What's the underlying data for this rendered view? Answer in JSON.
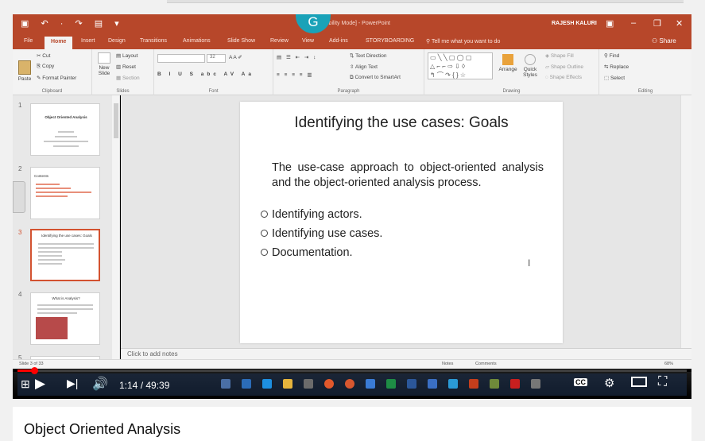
{
  "powerpoint": {
    "window_title": "ibility Mode] - PowerPoint",
    "user": "RAJESH KALURI",
    "tabs": [
      "File",
      "Home",
      "Insert",
      "Design",
      "Transitions",
      "Animations",
      "Slide Show",
      "Review",
      "View",
      "Add-ins",
      "STORYBOARDING"
    ],
    "active_tab": "Home",
    "tell_me": "Tell me what you want to do",
    "share": "Share",
    "ribbon": {
      "clipboard": {
        "paste": "Paste",
        "cut": "Cut",
        "copy": "Copy",
        "format_painter": "Format Painter",
        "group": "Clipboard"
      },
      "slides": {
        "new_slide": "New Slide",
        "layout": "Layout",
        "reset": "Reset",
        "section": "Section",
        "group": "Slides"
      },
      "font": {
        "size": "32",
        "group": "Font"
      },
      "paragraph": {
        "text_direction": "Text Direction",
        "align_text": "Align Text",
        "smartart": "Convert to SmartArt",
        "group": "Paragraph"
      },
      "drawing": {
        "arrange": "Arrange",
        "quick_styles": "Quick Styles",
        "shape_fill": "Shape Fill",
        "shape_outline": "Shape Outline",
        "shape_effects": "Shape Effects",
        "group": "Drawing"
      },
      "editing": {
        "find": "Find",
        "replace": "Replace",
        "select": "Select",
        "group": "Editing"
      }
    },
    "thumbnails": [
      {
        "num": "1",
        "title": "Object Oriented Analysis"
      },
      {
        "num": "2",
        "title": "Contents"
      },
      {
        "num": "3",
        "title": "Identifying the use cases: Goals"
      },
      {
        "num": "4",
        "title": "What is Analysis?"
      },
      {
        "num": "5",
        "title": ""
      }
    ],
    "slide": {
      "title": "Identifying the use cases: Goals",
      "paragraph": "The use-case approach to object-oriented analysis and the object-oriented analysis process.",
      "bullets": [
        "Identifying actors.",
        "Identifying use cases.",
        "Documentation."
      ]
    },
    "notes_placeholder": "Click to add notes",
    "status": {
      "slide_of": "Slide 3 of 33",
      "notes": "Notes",
      "comments": "Comments",
      "zoom": "68%"
    }
  },
  "video": {
    "current_time": "1:14",
    "duration": "49:39",
    "timecode": "1:14 / 49:39",
    "progress_fraction": 0.0248,
    "cc": "CC",
    "title": "Object Oriented Analysis"
  },
  "colors": {
    "ppt_red": "#b7472a",
    "youtube_red": "#ff0000",
    "grammarly_teal": "#1aa2b8"
  }
}
